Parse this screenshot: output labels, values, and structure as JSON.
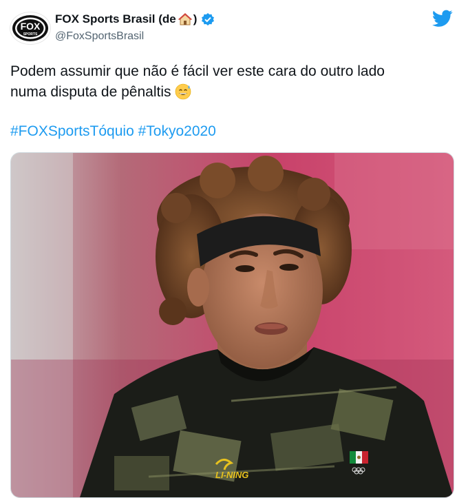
{
  "tweet": {
    "display_name": "FOX Sports Brasil (de",
    "display_name_close": ")",
    "handle": "@FoxSportsBrasil",
    "text_line1": "Podem assumir que não é fácil ver este cara do outro lado",
    "text_line2": "numa disputa de pênaltis",
    "hashtags": [
      "#FOXSportsTóquio",
      "#Tokyo2020"
    ]
  },
  "logo": {
    "top": "FOX",
    "bottom": "SPORTS"
  },
  "jersey": {
    "brand": "LI-NING"
  },
  "icons": {
    "avatar": "fox-sports-logo",
    "house": "house-icon",
    "verified": "verified-badge-icon",
    "bird": "twitter-bird-icon",
    "emoji": "sweat-smile-emoji"
  },
  "colors": {
    "link": "#1d9bf0",
    "verified": "#1d9bf0",
    "text": "#0f1419",
    "muted": "#536471"
  }
}
